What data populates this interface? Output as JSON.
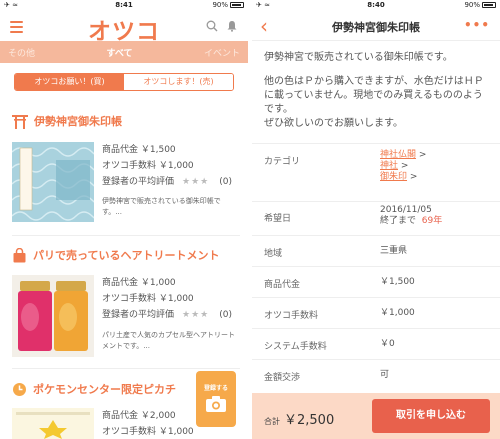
{
  "left": {
    "status": {
      "carrier": "✈ ≈",
      "time": "8:41",
      "battery": "90%"
    },
    "header": {
      "logo": "オツコ"
    },
    "tabs": [
      "その他",
      "すべて",
      "イベント"
    ],
    "segment": {
      "buy": "オツコお願い！(買)",
      "sell": "オツコします！(売)"
    },
    "items": [
      {
        "title": "伊勢神宮御朱印帳",
        "price_label": "商品代金",
        "price": "￥1,500",
        "fee_label": "オツコ手数料",
        "fee": "￥1,000",
        "rating_label": "登録者の平均評価",
        "rating_count": "(0)",
        "desc": "伊勢神宮で販売されている御朱印帳です。..."
      },
      {
        "title": "パリで売っているヘアトリートメント",
        "price_label": "商品代金",
        "price": "￥1,000",
        "fee_label": "オツコ手数料",
        "fee": "￥1,000",
        "rating_label": "登録者の平均評価",
        "rating_count": "(0)",
        "desc": "パリ土産で人気のカプセル型ヘアトリートメントです。..."
      },
      {
        "title": "ポケモンセンター限定ピカチ",
        "price_label": "商品代金",
        "price": "￥2,000",
        "fee_label": "オツコ手数料",
        "fee": "￥1,000"
      }
    ],
    "camera_button": "登録する"
  },
  "right": {
    "status": {
      "carrier": "✈ ≈",
      "time": "8:40",
      "battery": "90%"
    },
    "header": {
      "title": "伊勢神宮御朱印帳"
    },
    "body": [
      "伊勢神宮で販売されている御朱印帳です。",
      "他の色はＰから購入できますが、水色だけはＨＰに載っていません。現地でのみ買えるもののようです。",
      "ぜひ欲しいのでお願いします。"
    ],
    "details": {
      "category_label": "カテゴリ",
      "category": [
        "神社仏閣",
        "神社",
        "御朱印"
      ],
      "deadline_label": "希望日",
      "deadline_date": "2016/11/05",
      "deadline_suffix": "終了まで",
      "deadline_days": "69年",
      "region_label": "地域",
      "region": "三重県",
      "price_label": "商品代金",
      "price": "￥1,500",
      "fee_label": "オツコ手数料",
      "fee": "￥1,000",
      "sysfee_label": "システム手数料",
      "sysfee": "￥0",
      "nego_label": "金額交渉",
      "nego": "可"
    },
    "footer": {
      "total_label": "合計",
      "total": "￥2,500",
      "apply": "取引を申し込む"
    }
  },
  "colors": {
    "accent": "#f07a4d",
    "tabbar": "#f5b89c",
    "footer": "#fcd9c6",
    "apply": "#e8614c"
  }
}
